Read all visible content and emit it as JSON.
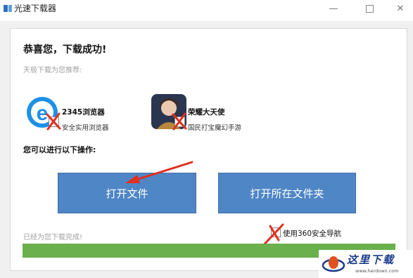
{
  "window": {
    "title": "光速下载器",
    "minimize_glyph": "—",
    "close_glyph": "✕"
  },
  "main": {
    "success_title": "恭喜您，下载成功!",
    "recommend_label": "天极下载为您推荐:",
    "recommendations": [
      {
        "name": "2345浏览器",
        "desc": "安全实用浏览器",
        "icon": "browser-e-icon",
        "checked": false
      },
      {
        "name": "荣耀大天使",
        "desc": "国民打宝魔幻手游",
        "icon": "game-avatar-icon",
        "checked": false
      }
    ],
    "ops_label": "您可以进行以下操作:",
    "open_file_label": "打开文件",
    "open_folder_label": "打开所在文件夹",
    "done_label": "已经为您下载完成!",
    "nav_option_label": "使用360安全导航",
    "nav_option_checked": false,
    "progress": 1.0
  },
  "watermark": {
    "text": "这里下载",
    "url": "www.herdown.com"
  },
  "colors": {
    "button_blue": "#4f86c6",
    "progress_green": "#6ab04c",
    "annotation_red": "#e03020"
  }
}
